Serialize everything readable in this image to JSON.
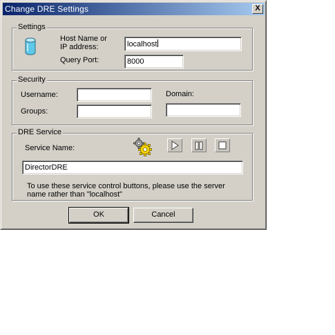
{
  "window": {
    "title": "Change DRE Settings",
    "close_glyph": "X"
  },
  "settings": {
    "legend": "Settings",
    "host_label_line1": "Host Name or",
    "host_label_line2": "IP address:",
    "host_value": "localhost",
    "port_label": "Query Port:",
    "port_value": "8000",
    "icon": "database-icon"
  },
  "security": {
    "legend": "Security",
    "username_label": "Username:",
    "username_value": "",
    "groups_label": "Groups:",
    "groups_value": "",
    "domain_label": "Domain:",
    "domain_value": ""
  },
  "dre_service": {
    "legend": "DRE Service",
    "service_name_label": "Service Name:",
    "service_name_value": "DirectorDRE",
    "note_line1": "To use these service control buttons, please use the server",
    "note_line2": "name rather than \"localhost\"",
    "icons": [
      "services-gear-icon",
      "play-icon",
      "pause-icon",
      "stop-icon"
    ]
  },
  "buttons": {
    "ok": "OK",
    "cancel": "Cancel"
  },
  "colors": {
    "titlebar_start": "#0a246a",
    "titlebar_end": "#a6caf0",
    "face": "#d4d0c8"
  }
}
